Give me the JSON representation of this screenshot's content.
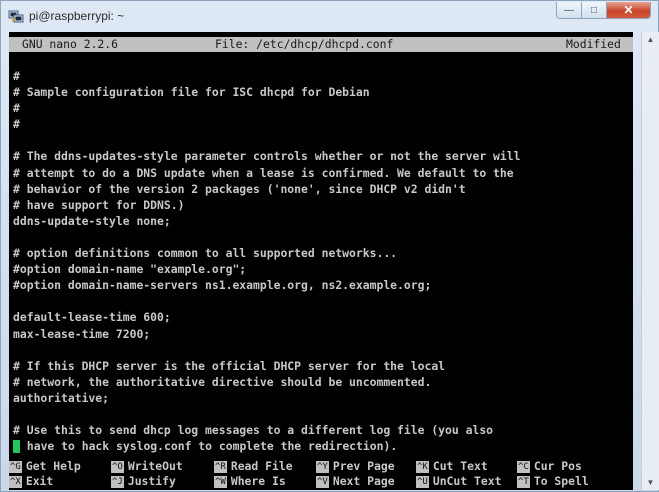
{
  "window": {
    "title": "pi@raspberrypi: ~",
    "controls": [
      "minimize",
      "maximize",
      "close"
    ]
  },
  "nano_header": {
    "version": "GNU nano 2.2.6",
    "file": "File: /etc/dhcp/dhcpd.conf",
    "status": "Modified"
  },
  "editor_lines": [
    "#",
    "# Sample configuration file for ISC dhcpd for Debian",
    "#",
    "#",
    "",
    "# The ddns-updates-style parameter controls whether or not the server will",
    "# attempt to do a DNS update when a lease is confirmed. We default to the",
    "# behavior of the version 2 packages ('none', since DHCP v2 didn't",
    "# have support for DDNS.)",
    "ddns-update-style none;",
    "",
    "# option definitions common to all supported networks...",
    "#option domain-name \"example.org\";",
    "#option domain-name-servers ns1.example.org, ns2.example.org;",
    "",
    "default-lease-time 600;",
    "max-lease-time 7200;",
    "",
    "# If this DHCP server is the official DHCP server for the local",
    "# network, the authoritative directive should be uncommented.",
    "authoritative;",
    "",
    "# Use this to send dhcp log messages to a different log file (you also"
  ],
  "cursor_line_text": " have to hack syslog.conf to complete the redirection).",
  "shortcuts_row1": [
    {
      "key": "^G",
      "label": "Get Help"
    },
    {
      "key": "^O",
      "label": "WriteOut"
    },
    {
      "key": "^R",
      "label": "Read File"
    },
    {
      "key": "^Y",
      "label": "Prev Page"
    },
    {
      "key": "^K",
      "label": "Cut Text"
    },
    {
      "key": "^C",
      "label": "Cur Pos"
    }
  ],
  "shortcuts_row2": [
    {
      "key": "^X",
      "label": "Exit"
    },
    {
      "key": "^J",
      "label": "Justify"
    },
    {
      "key": "^W",
      "label": "Where Is"
    },
    {
      "key": "^V",
      "label": "Next Page"
    },
    {
      "key": "^U",
      "label": "UnCut Text"
    },
    {
      "key": "^T",
      "label": "To Spell"
    }
  ],
  "colors": {
    "terminal_bg": "#000000",
    "terminal_fg": "#c8c8c8",
    "cursor": "#22c55e",
    "header_bg": "#c0c0c0"
  },
  "icons": {
    "app": "putty-terminal-icon",
    "scroll_up": "scroll-up-arrow-icon",
    "scroll_down": "scroll-down-arrow-icon"
  }
}
